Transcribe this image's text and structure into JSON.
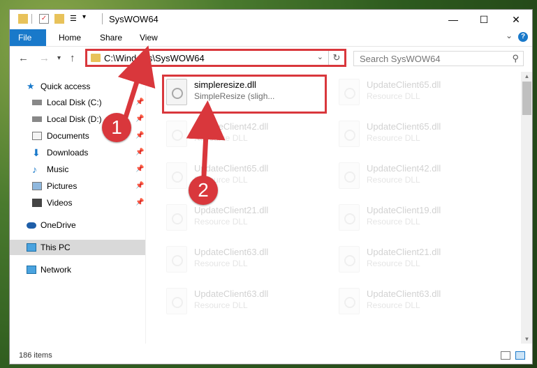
{
  "window": {
    "title": "SysWOW64"
  },
  "ribbon": {
    "tabs": [
      "File",
      "Home",
      "Share",
      "View"
    ]
  },
  "address": {
    "path": "C:\\Windows\\SysWOW64"
  },
  "search": {
    "placeholder": "Search SysWOW64"
  },
  "nav": {
    "quick_access": "Quick access",
    "items": [
      {
        "label": "Local Disk (C:)",
        "icon": "drive-icon"
      },
      {
        "label": "Local Disk (D:)",
        "icon": "drive-icon"
      },
      {
        "label": "Documents",
        "icon": "documents-icon"
      },
      {
        "label": "Downloads",
        "icon": "downloads-icon"
      },
      {
        "label": "Music",
        "icon": "music-icon"
      },
      {
        "label": "Pictures",
        "icon": "pictures-icon"
      },
      {
        "label": "Videos",
        "icon": "videos-icon"
      }
    ],
    "onedrive": "OneDrive",
    "this_pc": "This PC",
    "network": "Network"
  },
  "files": [
    {
      "name": "simpleresize.dll",
      "desc": "SimpleResize (sligh..."
    },
    {
      "name": "UpdateClient65.dll",
      "desc": "Resource DLL"
    },
    {
      "name": "UpdateClient42.dll",
      "desc": "Resource DLL"
    },
    {
      "name": "UpdateClient65.dll",
      "desc": "Resource DLL"
    },
    {
      "name": "UpdateClient65.dll",
      "desc": "Resource DLL"
    },
    {
      "name": "UpdateClient42.dll",
      "desc": "Resource DLL"
    },
    {
      "name": "UpdateClient21.dll",
      "desc": "Resource DLL"
    },
    {
      "name": "UpdateClient19.dll",
      "desc": "Resource DLL"
    },
    {
      "name": "UpdateClient63.dll",
      "desc": "Resource DLL"
    },
    {
      "name": "UpdateClient21.dll",
      "desc": "Resource DLL"
    },
    {
      "name": "UpdateClient63.dll",
      "desc": "Resource DLL"
    },
    {
      "name": "UpdateClient63.dll",
      "desc": "Resource DLL"
    }
  ],
  "status": {
    "count": "186 items"
  },
  "annotations": {
    "badge1": "1",
    "badge2": "2"
  },
  "colors": {
    "accent": "#1979ca",
    "highlight": "#d9373c"
  }
}
